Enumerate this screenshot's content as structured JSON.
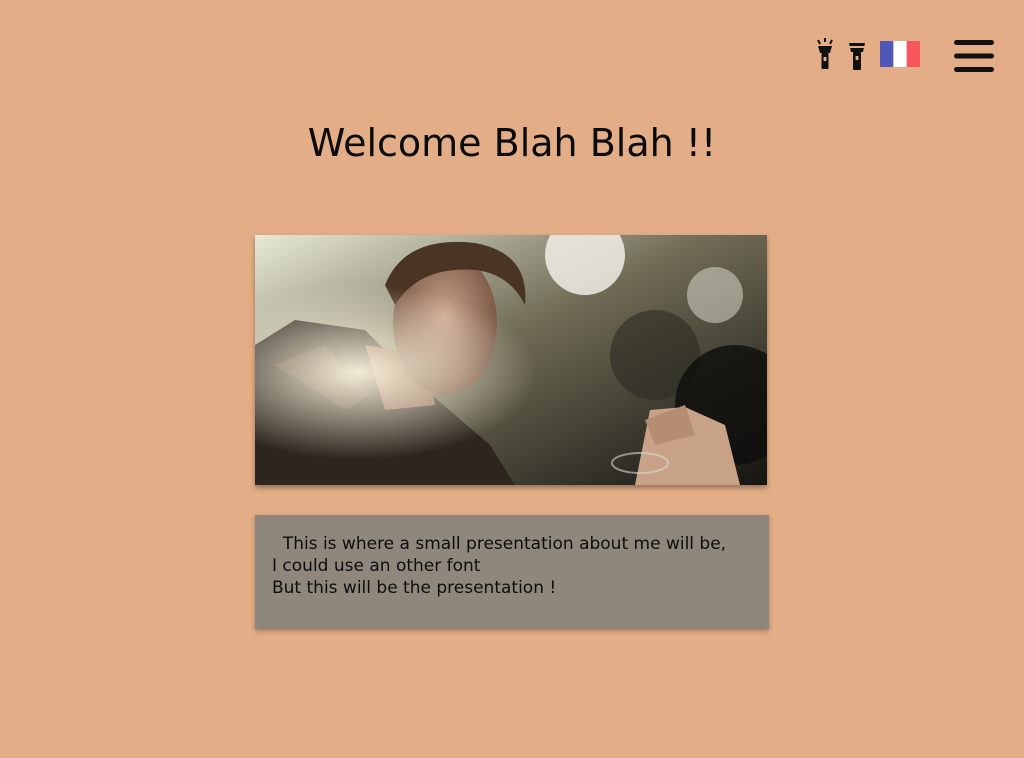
{
  "header": {
    "icons": [
      "flashlight-on-icon",
      "flashlight-off-icon",
      "france-flag-icon",
      "hamburger-menu-icon"
    ],
    "flag_colors": {
      "blue": "#4f57b8",
      "white": "#ffffff",
      "red": "#f7565f"
    }
  },
  "main": {
    "title": "Welcome Blah Blah !!",
    "presentation_lines": [
      "  This is where a small presentation about me will be,",
      "I could use an other font",
      "But this will be the presentation !"
    ]
  },
  "colors": {
    "background": "#e3ae87",
    "presentation_box": "#8f877b"
  }
}
